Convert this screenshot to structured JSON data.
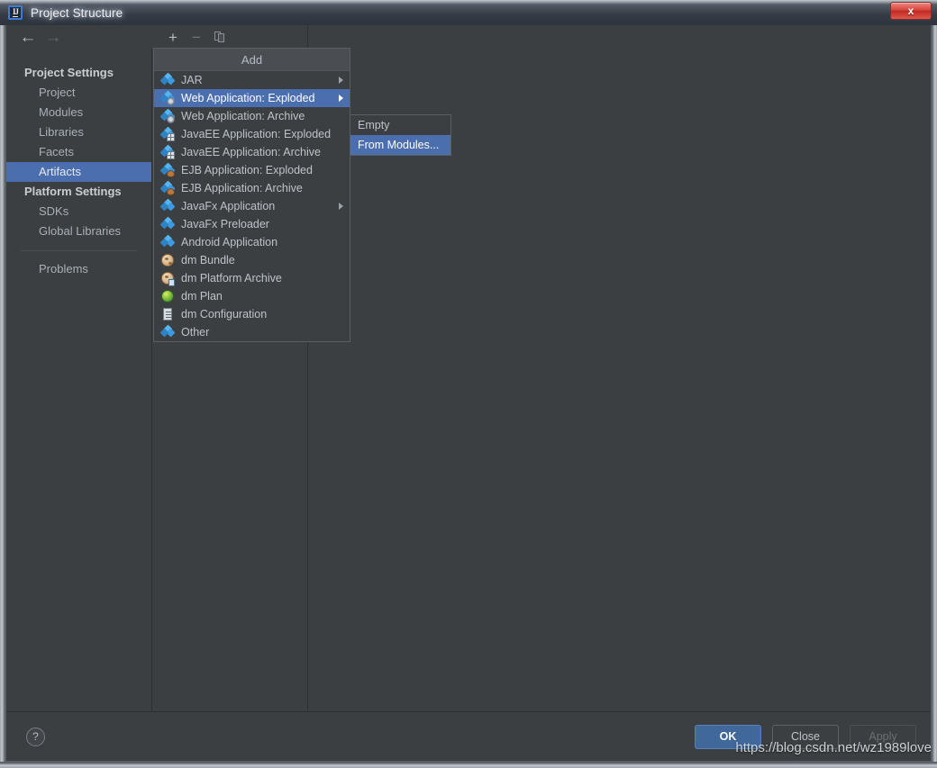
{
  "window": {
    "title": "Project Structure",
    "app_icon": "intellij-idea-icon",
    "close_label": "✕"
  },
  "nav": {
    "back_icon": "←",
    "forward_icon": "→"
  },
  "toolbar": {
    "add_icon": "+",
    "remove_icon": "−",
    "copy_icon": "copy-icon"
  },
  "sidebar": {
    "groups": [
      {
        "label": "Project Settings",
        "items": [
          {
            "label": "Project",
            "selected": false
          },
          {
            "label": "Modules",
            "selected": false
          },
          {
            "label": "Libraries",
            "selected": false
          },
          {
            "label": "Facets",
            "selected": false
          },
          {
            "label": "Artifacts",
            "selected": true
          }
        ]
      },
      {
        "label": "Platform Settings",
        "items": [
          {
            "label": "SDKs",
            "selected": false
          },
          {
            "label": "Global Libraries",
            "selected": false
          }
        ]
      }
    ],
    "problems": {
      "label": "Problems",
      "selected": false
    }
  },
  "add_menu": {
    "header": "Add",
    "items": [
      {
        "label": "JAR",
        "icon": "artifact-jar-icon",
        "has_submenu": true,
        "selected": false
      },
      {
        "label": "Web Application: Exploded",
        "icon": "web-app-exploded-icon",
        "has_submenu": true,
        "selected": true
      },
      {
        "label": "Web Application: Archive",
        "icon": "web-app-archive-icon",
        "has_submenu": false,
        "selected": false
      },
      {
        "label": "JavaEE Application: Exploded",
        "icon": "javaee-exploded-icon",
        "has_submenu": false,
        "selected": false
      },
      {
        "label": "JavaEE Application: Archive",
        "icon": "javaee-archive-icon",
        "has_submenu": false,
        "selected": false
      },
      {
        "label": "EJB Application: Exploded",
        "icon": "ejb-exploded-icon",
        "has_submenu": false,
        "selected": false
      },
      {
        "label": "EJB Application: Archive",
        "icon": "ejb-archive-icon",
        "has_submenu": false,
        "selected": false
      },
      {
        "label": "JavaFx Application",
        "icon": "javafx-app-icon",
        "has_submenu": true,
        "selected": false
      },
      {
        "label": "JavaFx Preloader",
        "icon": "javafx-preloader-icon",
        "has_submenu": false,
        "selected": false
      },
      {
        "label": "Android Application",
        "icon": "android-app-icon",
        "has_submenu": false,
        "selected": false
      },
      {
        "label": "dm Bundle",
        "icon": "dm-bundle-icon",
        "has_submenu": false,
        "selected": false
      },
      {
        "label": "dm Platform Archive",
        "icon": "dm-platform-archive-icon",
        "has_submenu": false,
        "selected": false
      },
      {
        "label": "dm Plan",
        "icon": "dm-plan-icon",
        "has_submenu": false,
        "selected": false
      },
      {
        "label": "dm Configuration",
        "icon": "dm-configuration-icon",
        "has_submenu": false,
        "selected": false
      },
      {
        "label": "Other",
        "icon": "other-artifact-icon",
        "has_submenu": false,
        "selected": false
      }
    ]
  },
  "sub_menu": {
    "items": [
      {
        "label": "Empty",
        "selected": false
      },
      {
        "label": "From Modules...",
        "selected": true
      }
    ]
  },
  "footer": {
    "help_label": "?",
    "buttons": [
      {
        "label": "OK",
        "style": "default"
      },
      {
        "label": "Close",
        "style": "normal"
      },
      {
        "label": "Apply",
        "style": "disabled"
      }
    ]
  },
  "watermark": "https://blog.csdn.net/wz1989love",
  "colors": {
    "accent_blue": "#4b6eaf",
    "panel_bg": "#3c3f41",
    "titlebar_dark": "#2f353e",
    "close_red": "#d9453c",
    "text_primary": "#bdc3cb"
  }
}
